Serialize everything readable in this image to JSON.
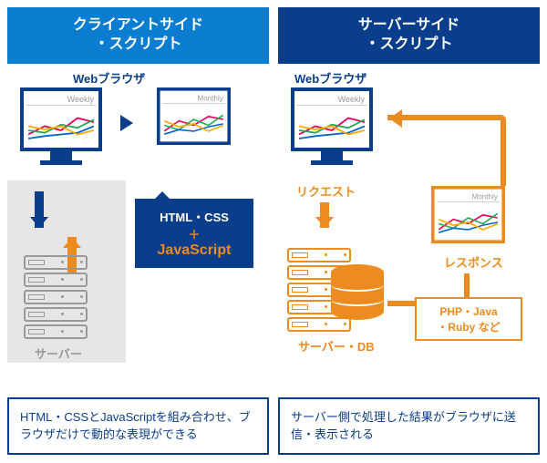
{
  "left": {
    "header_line1": "クライアントサイド",
    "header_line2": "・スクリプト",
    "browser_label": "Webブラウザ",
    "screen1_label": "Weekly",
    "screen2_label": "Monthly",
    "callout_line1": "HTML・CSS",
    "callout_plus": "＋",
    "callout_js": "JavaScript",
    "server_label": "サーバー",
    "footer": "HTML・CSSとJavaScriptを組み合わせ、ブラウザだけで動的な表現ができる"
  },
  "right": {
    "header_line1": "サーバーサイド",
    "header_line2": "・スクリプト",
    "browser_label": "Webブラウザ",
    "screen1_label": "Weekly",
    "screen2_label": "Monthly",
    "request_label": "リクエスト",
    "response_label": "レスポンス",
    "server_label": "サーバー・DB",
    "tech_line1": "PHP・Java",
    "tech_line2": "・Ruby など",
    "footer": "サーバー側で処理した結果がブラウザに送信・表示される"
  }
}
